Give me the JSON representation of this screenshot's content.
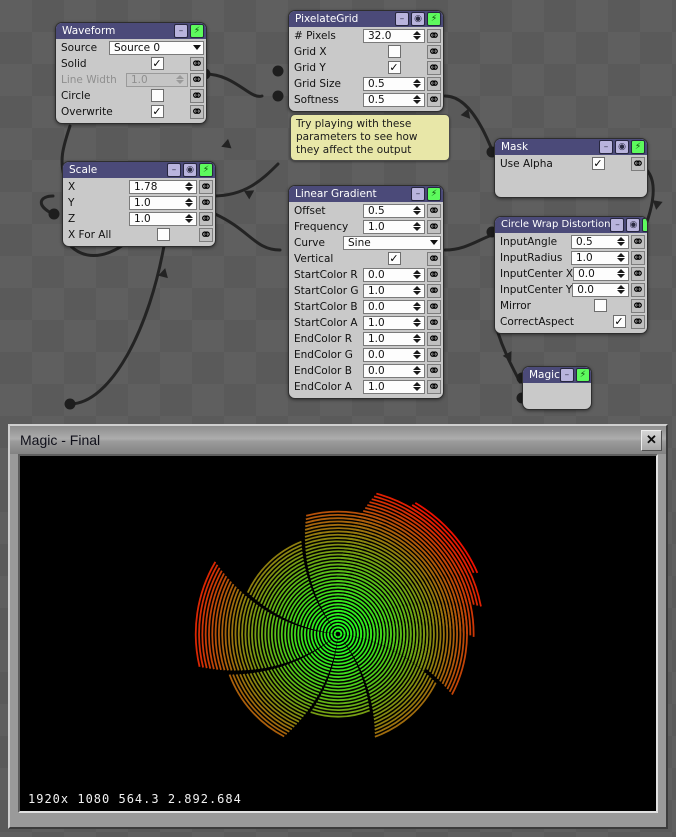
{
  "graph": {
    "nodes": [
      {
        "id": "waveform",
        "title": "Waveform",
        "header_buttons": [
          "minus-icon",
          "bolt-icon"
        ],
        "rows": [
          {
            "label": "Source",
            "type": "combo",
            "value": "Source 0",
            "link": false
          },
          {
            "label": "Solid",
            "type": "check",
            "value": "checked",
            "link": true
          },
          {
            "label": "Line Width",
            "type": "number",
            "value": "1.0",
            "link": true,
            "disabled": true
          },
          {
            "label": "Circle",
            "type": "check",
            "value": "",
            "link": true
          },
          {
            "label": "Overwrite",
            "type": "check",
            "value": "checked",
            "link": true
          }
        ]
      },
      {
        "id": "scale",
        "title": "Scale",
        "header_buttons": [
          "minus-icon",
          "circle-icon",
          "bolt-icon"
        ],
        "rows": [
          {
            "label": "X",
            "type": "number",
            "value": "1.78",
            "link": true
          },
          {
            "label": "Y",
            "type": "number",
            "value": "1.0",
            "link": true
          },
          {
            "label": "Z",
            "type": "number",
            "value": "1.0",
            "link": true
          },
          {
            "label": "X For All",
            "type": "check",
            "value": "",
            "link": true
          }
        ]
      },
      {
        "id": "pixelategrid",
        "title": "PixelateGrid",
        "header_buttons": [
          "minus-icon",
          "circle-icon",
          "bolt-icon"
        ],
        "rows": [
          {
            "label": "# Pixels",
            "type": "number",
            "value": "32.0",
            "link": true
          },
          {
            "label": "Grid X",
            "type": "check",
            "value": "",
            "link": true
          },
          {
            "label": "Grid Y",
            "type": "check",
            "value": "checked",
            "link": true
          },
          {
            "label": "Grid Size",
            "type": "number",
            "value": "0.5",
            "link": true
          },
          {
            "label": "Softness",
            "type": "number",
            "value": "0.5",
            "link": true
          }
        ]
      },
      {
        "id": "lineargradient",
        "title": "Linear Gradient",
        "header_buttons": [
          "minus-icon",
          "bolt-icon"
        ],
        "rows": [
          {
            "label": "Offset",
            "type": "number",
            "value": "0.5",
            "link": true
          },
          {
            "label": "Frequency",
            "type": "number",
            "value": "1.0",
            "link": true
          },
          {
            "label": "Curve",
            "type": "combo",
            "value": "Sine",
            "link": false
          },
          {
            "label": "Vertical",
            "type": "check",
            "value": "checked",
            "link": true
          },
          {
            "label": "StartColor R",
            "type": "number",
            "value": "0.0",
            "link": true
          },
          {
            "label": "StartColor G",
            "type": "number",
            "value": "1.0",
            "link": true
          },
          {
            "label": "StartColor B",
            "type": "number",
            "value": "0.0",
            "link": true
          },
          {
            "label": "StartColor A",
            "type": "number",
            "value": "1.0",
            "link": true
          },
          {
            "label": "EndColor R",
            "type": "number",
            "value": "1.0",
            "link": true
          },
          {
            "label": "EndColor G",
            "type": "number",
            "value": "0.0",
            "link": true
          },
          {
            "label": "EndColor B",
            "type": "number",
            "value": "0.0",
            "link": true
          },
          {
            "label": "EndColor A",
            "type": "number",
            "value": "1.0",
            "link": true
          }
        ]
      },
      {
        "id": "mask",
        "title": "Mask",
        "header_buttons": [
          "minus-icon",
          "circle-icon",
          "bolt-icon"
        ],
        "rows": [
          {
            "label": "Use Alpha",
            "type": "check",
            "value": "checked",
            "link": true
          }
        ]
      },
      {
        "id": "circlewrap",
        "title": "Circle Wrap Distortion",
        "header_buttons": [
          "minus-icon",
          "circle-icon",
          "bolt-icon"
        ],
        "rows": [
          {
            "label": "InputAngle",
            "type": "number",
            "value": "0.5",
            "link": true
          },
          {
            "label": "InputRadius",
            "type": "number",
            "value": "1.0",
            "link": true
          },
          {
            "label": "InputCenter X",
            "type": "number",
            "value": "0.0",
            "link": true
          },
          {
            "label": "InputCenter Y",
            "type": "number",
            "value": "0.0",
            "link": true
          },
          {
            "label": "Mirror",
            "type": "check",
            "value": "",
            "link": true
          },
          {
            "label": "CorrectAspect",
            "type": "check",
            "value": "checked",
            "link": true
          }
        ]
      },
      {
        "id": "magic",
        "title": "Magic",
        "header_buttons": [
          "minus-icon",
          "bolt-icon"
        ],
        "rows": []
      }
    ],
    "note": {
      "lines": [
        "Try playing with these",
        "parameters to see how",
        "they affect the output"
      ]
    }
  },
  "preview": {
    "title": "Magic - Final",
    "close_label": "✕",
    "status": "1920x 1080  564.3  2.892.684",
    "artwork": {
      "description": "radial spiral of concentric rings",
      "color_inner": "#21ff21",
      "color_outer": "#ee1100",
      "background": "#000000"
    }
  },
  "theme": {
    "node_header": "#4b4a79",
    "node_body": "#c9c9c9",
    "accent_bolt": "#5dfa5d",
    "note_bg": "#e8e7a8",
    "canvas_bg": "#5f5f5f"
  }
}
